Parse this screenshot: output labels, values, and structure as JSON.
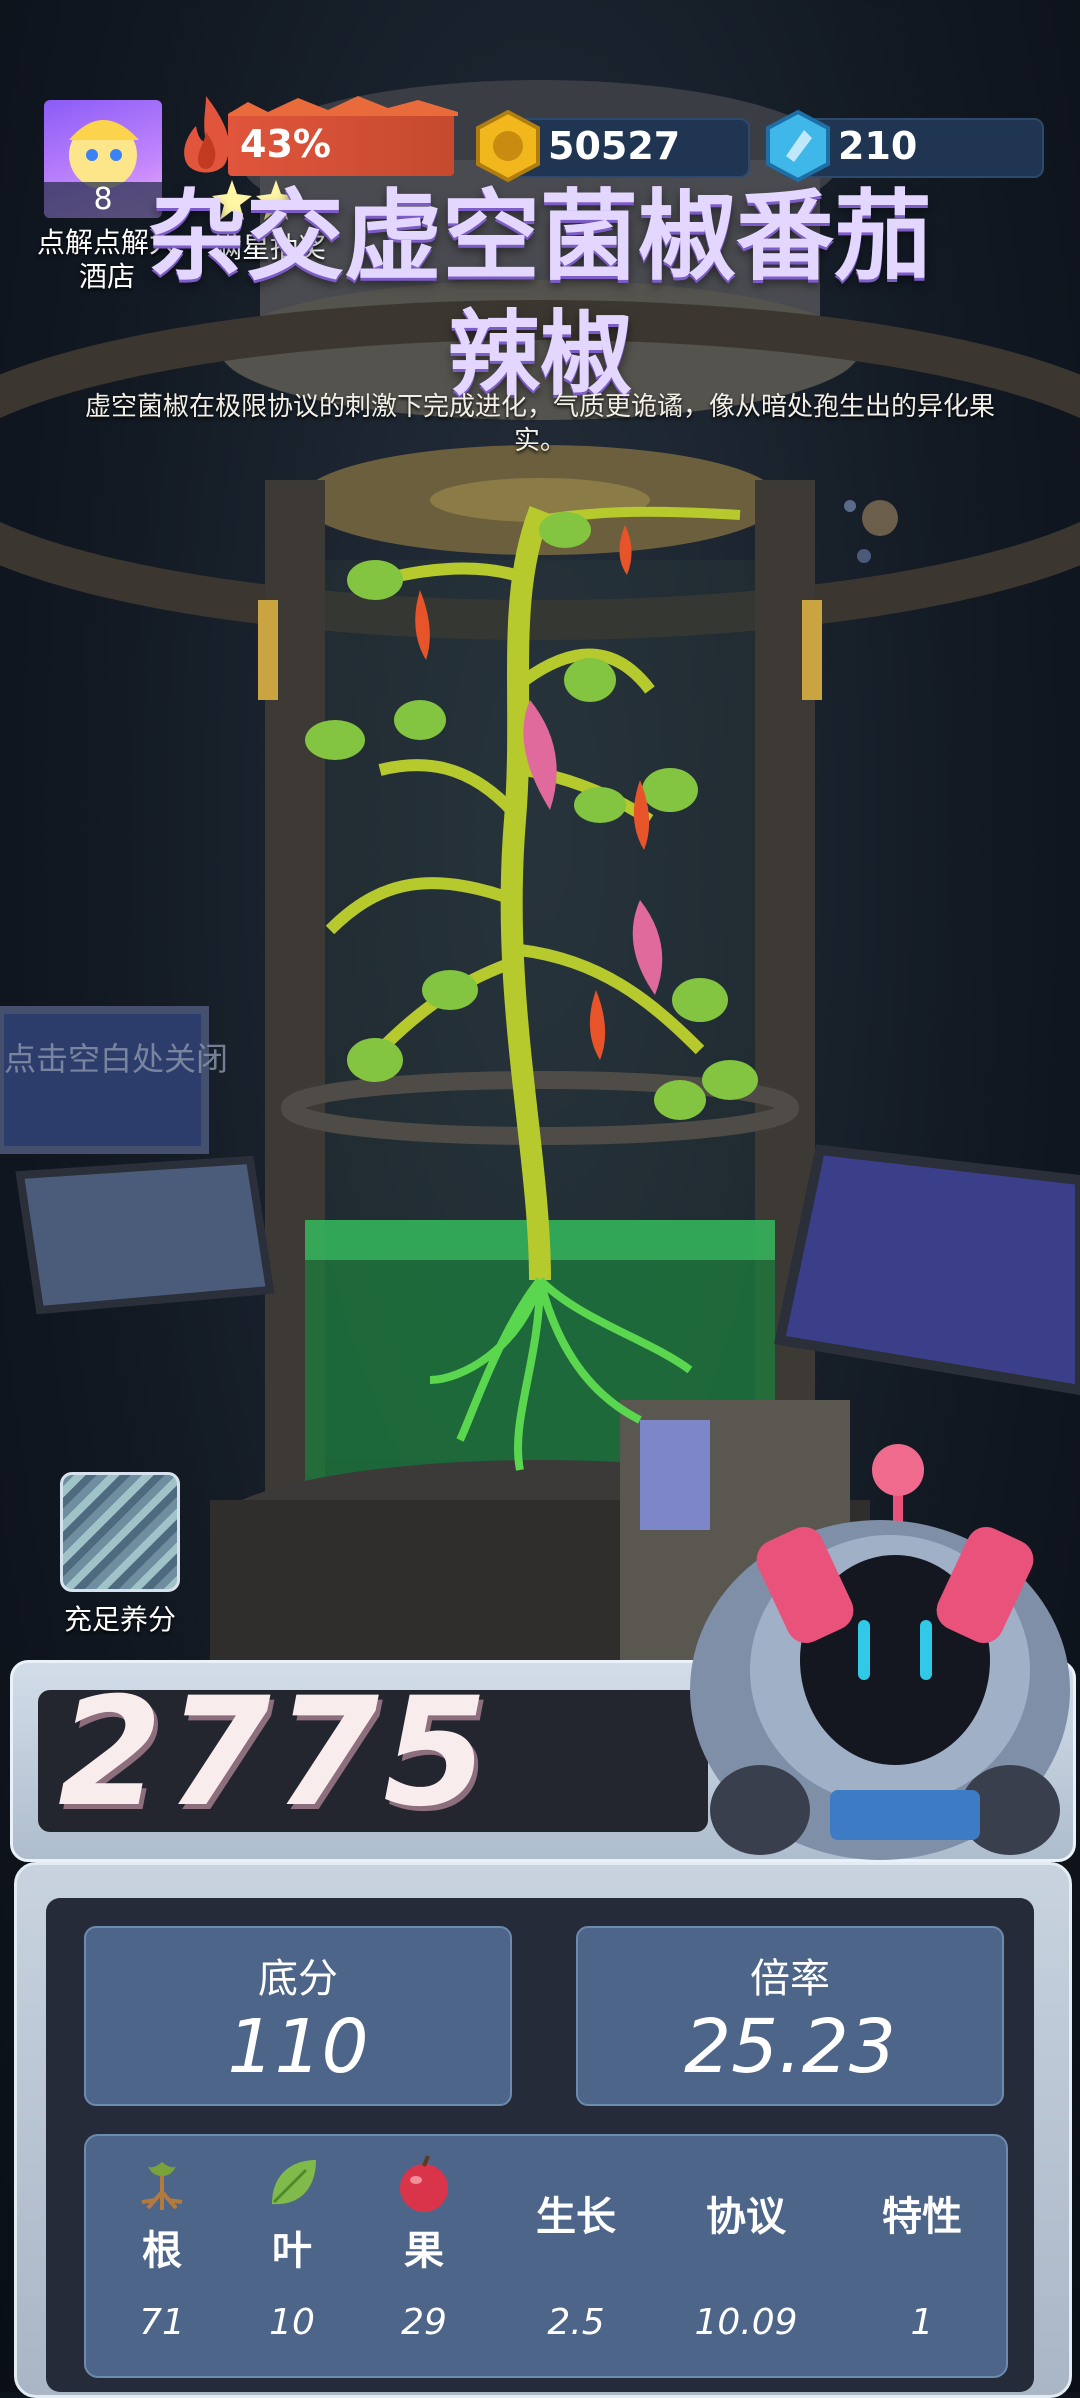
{
  "player": {
    "level": "8"
  },
  "hud": {
    "fire_percent": "43%",
    "coins": "50527",
    "gems": "210",
    "hotel_label": "点解点解大\n酒店",
    "lottery_label": "满星抽奖"
  },
  "plant": {
    "title_line1": "杂交虚空菌椒番茄",
    "title_line2": "辣椒",
    "description": "虚空菌椒在极限协议的刺激下完成进化，气质更诡谲，像从暗处孢生出的异化果实。"
  },
  "close_hint": "点击空白处关闭",
  "nutrient_label": "充足养分",
  "score": {
    "total": "2775"
  },
  "stats": {
    "base_label": "底分",
    "base_value": "110",
    "multiplier_label": "倍率",
    "multiplier_value": "25.23",
    "columns": [
      {
        "label": "根",
        "value": "71",
        "icon": "root-icon"
      },
      {
        "label": "叶",
        "value": "10",
        "icon": "leaf-icon"
      },
      {
        "label": "果",
        "value": "29",
        "icon": "fruit-icon"
      },
      {
        "label": "生长",
        "value": "2.5"
      },
      {
        "label": "协议",
        "value": "10.09"
      },
      {
        "label": "特性",
        "value": "1"
      }
    ]
  },
  "colors": {
    "fire_bar": "#e0553c",
    "coin": "#f3b71e",
    "gem": "#3fb7e8",
    "panel_blue": "#4d6588",
    "liquid": "#2ecc71"
  }
}
